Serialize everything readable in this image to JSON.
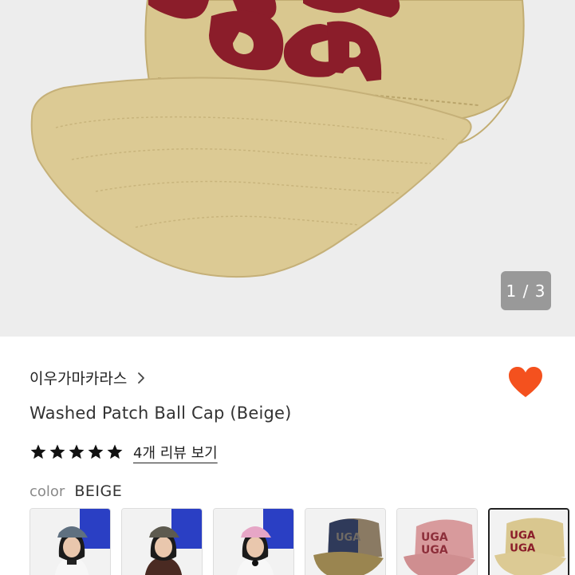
{
  "gallery": {
    "image_name": "washed-patch-ball-cap-beige",
    "page_indicator": "1 / 3"
  },
  "product": {
    "brand": "이우가마카라스",
    "title": "Washed Patch Ball Cap (Beige)",
    "rating_stars": 5,
    "review_link": "4개 리뷰 보기",
    "color_label": "color",
    "color_value": "BEIGE"
  },
  "thumbnails": [
    {
      "name": "model-denim-cap",
      "selected": false
    },
    {
      "name": "model-khaki-cap",
      "selected": false
    },
    {
      "name": "model-pink-cap",
      "selected": false
    },
    {
      "name": "navy-mesh-cap",
      "selected": false
    },
    {
      "name": "pink-cap",
      "selected": false
    },
    {
      "name": "beige-cap",
      "selected": true
    }
  ],
  "colors": {
    "heart": "#f4511e",
    "cap_beige": "#dcc88e",
    "patch_red": "#8b1d2a",
    "indicator_bg": "#7a7a7a"
  },
  "icons": {
    "brand_chevron": "chevron-right-icon",
    "wishlist": "heart-icon",
    "star": "star-icon"
  }
}
